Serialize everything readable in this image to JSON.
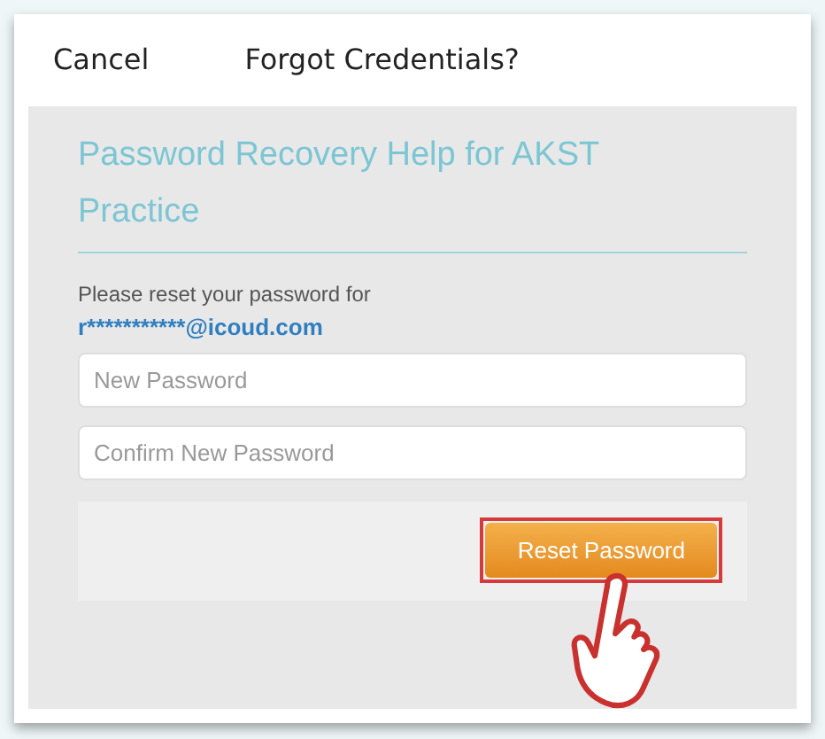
{
  "header": {
    "cancel": "Cancel",
    "title": "Forgot Credentials?"
  },
  "panel": {
    "heading": "Password Recovery Help for AKST Practice",
    "instruction": "Please reset your password for",
    "email": "r***********@icoud.com"
  },
  "fields": [
    {
      "placeholder": "New Password"
    },
    {
      "placeholder": "Confirm New Password"
    }
  ],
  "button": {
    "label": "Reset Password",
    "highlighted": true
  }
}
